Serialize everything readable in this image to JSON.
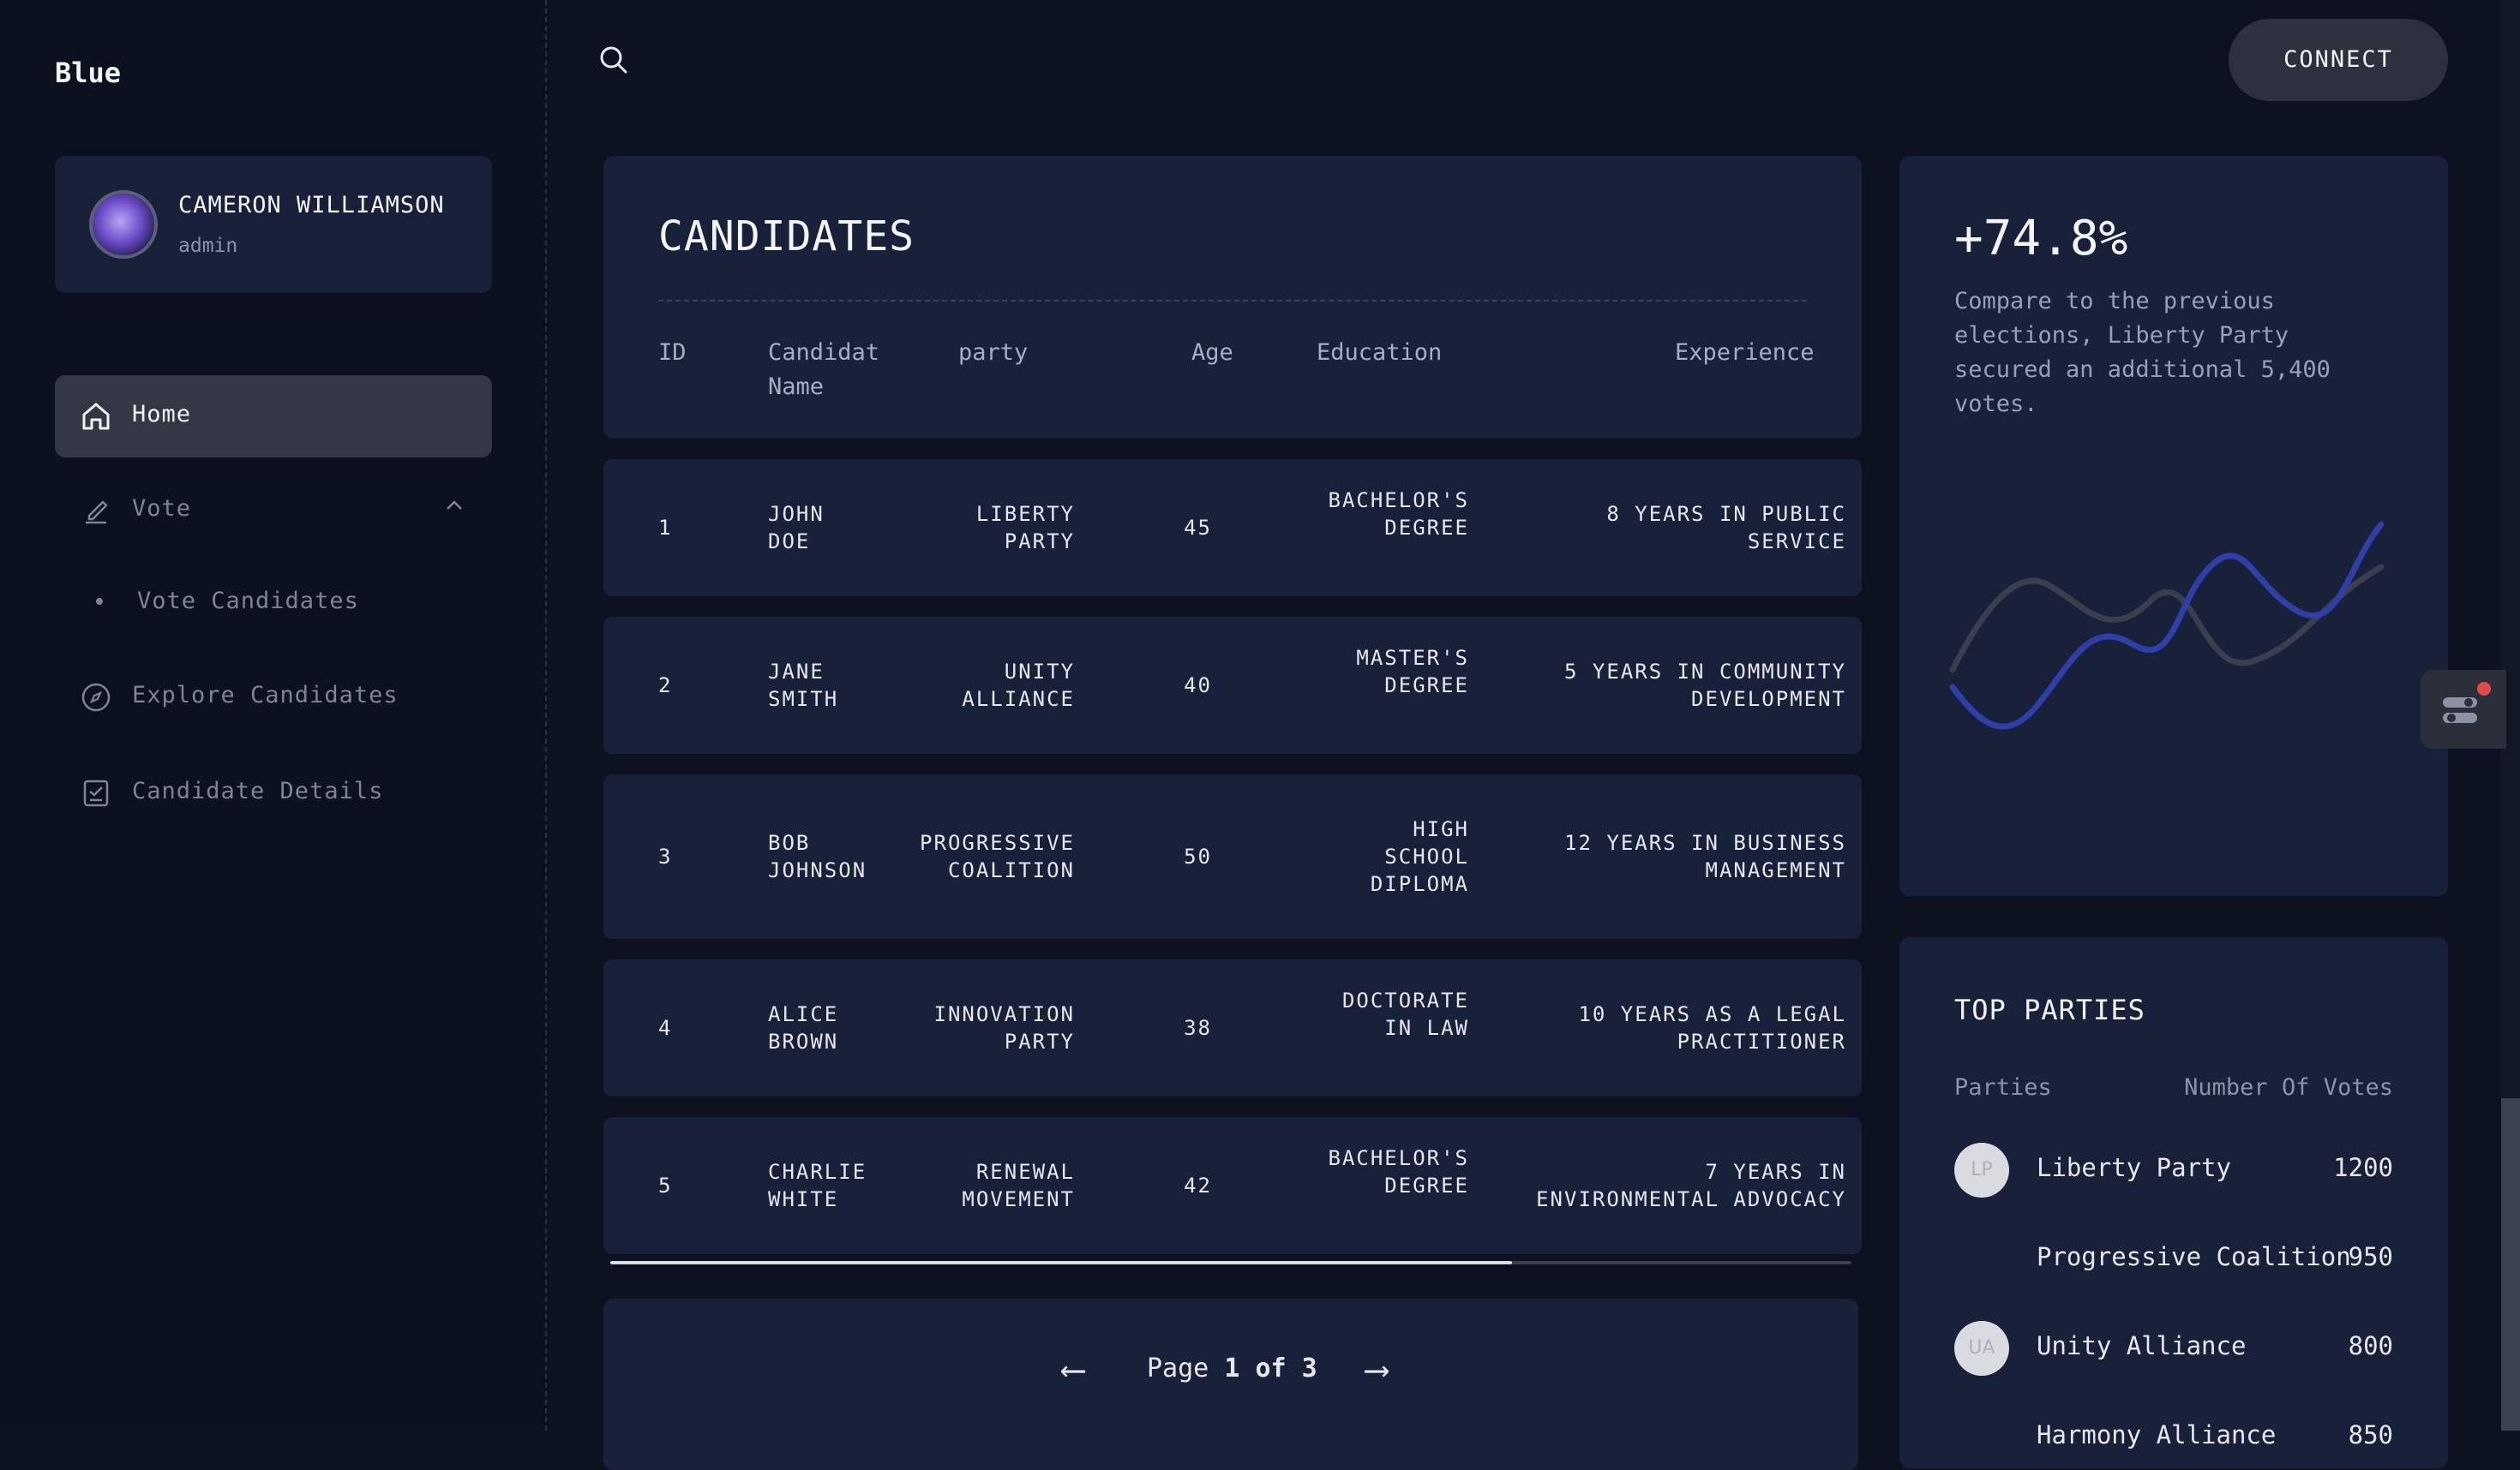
{
  "brand": "Blue",
  "profile": {
    "name": "CAMERON WILLIAMSON",
    "role": "admin"
  },
  "nav": {
    "home": "Home",
    "vote": "Vote",
    "vote_candidates": "Vote Candidates",
    "explore": "Explore Candidates",
    "details": "Candidate Details"
  },
  "header": {
    "connect": "CONNECT"
  },
  "candidates": {
    "title": "CANDIDATES",
    "columns": {
      "id": "ID",
      "name_1": "Candidat",
      "name_2": "Name",
      "party": "party",
      "age": "Age",
      "education": "Education",
      "experience": "Experience"
    },
    "rows": [
      {
        "id": "1",
        "name_1": "JOHN",
        "name_2": "DOE",
        "party_1": "LIBERTY",
        "party_2": "PARTY",
        "age": "45",
        "edu_1": "BACHELOR'S",
        "edu_2": "DEGREE",
        "edu_3": "",
        "exp_1": "8 YEARS IN PUBLIC",
        "exp_2": "SERVICE"
      },
      {
        "id": "2",
        "name_1": "JANE",
        "name_2": "SMITH",
        "party_1": "UNITY",
        "party_2": "ALLIANCE",
        "age": "40",
        "edu_1": "MASTER'S",
        "edu_2": "DEGREE",
        "edu_3": "",
        "exp_1": "5 YEARS IN COMMUNITY",
        "exp_2": "DEVELOPMENT"
      },
      {
        "id": "3",
        "name_1": "BOB",
        "name_2": "JOHNSON",
        "party_1": "PROGRESSIVE",
        "party_2": "COALITION",
        "age": "50",
        "edu_1": "HIGH",
        "edu_2": "SCHOOL",
        "edu_3": "DIPLOMA",
        "exp_1": "12 YEARS IN BUSINESS",
        "exp_2": "MANAGEMENT"
      },
      {
        "id": "4",
        "name_1": "ALICE",
        "name_2": "BROWN",
        "party_1": "INNOVATION",
        "party_2": "PARTY",
        "age": "38",
        "edu_1": "DOCTORATE",
        "edu_2": "IN LAW",
        "edu_3": "",
        "exp_1": "10 YEARS AS A LEGAL",
        "exp_2": "PRACTITIONER"
      },
      {
        "id": "5",
        "name_1": "CHARLIE",
        "name_2": "WHITE",
        "party_1": "RENEWAL",
        "party_2": "MOVEMENT",
        "age": "42",
        "edu_1": "BACHELOR'S",
        "edu_2": "DEGREE",
        "edu_3": "",
        "exp_1": "7 YEARS IN",
        "exp_2": "ENVIRONMENTAL ADVOCACY"
      }
    ],
    "table_scroll_fraction": 0.73,
    "pagination": {
      "prefix": "Page",
      "current": "1",
      "of": "of",
      "total": "3",
      "prev_icon": "arrow-left-icon",
      "next_icon": "arrow-right-icon"
    }
  },
  "stats": {
    "value": "+74.8%",
    "description": "Compare to the previous elections, Liberty Party secured an additional 5,400 votes.",
    "colors": {
      "primary_line": "#2f3fa8",
      "secondary_line": "#3a3f4d"
    }
  },
  "top_parties": {
    "title": "TOP PARTIES",
    "col_parties": "Parties",
    "col_votes": "Number Of Votes",
    "items": [
      {
        "initials": "LP",
        "name": "Liberty Party",
        "votes": "1200"
      },
      {
        "initials": "",
        "name": "Progressive Coalition",
        "votes": "950"
      },
      {
        "initials": "UA",
        "name": "Unity Alliance",
        "votes": "800"
      },
      {
        "initials": "",
        "name": "Harmony Alliance",
        "votes": "850"
      }
    ]
  }
}
